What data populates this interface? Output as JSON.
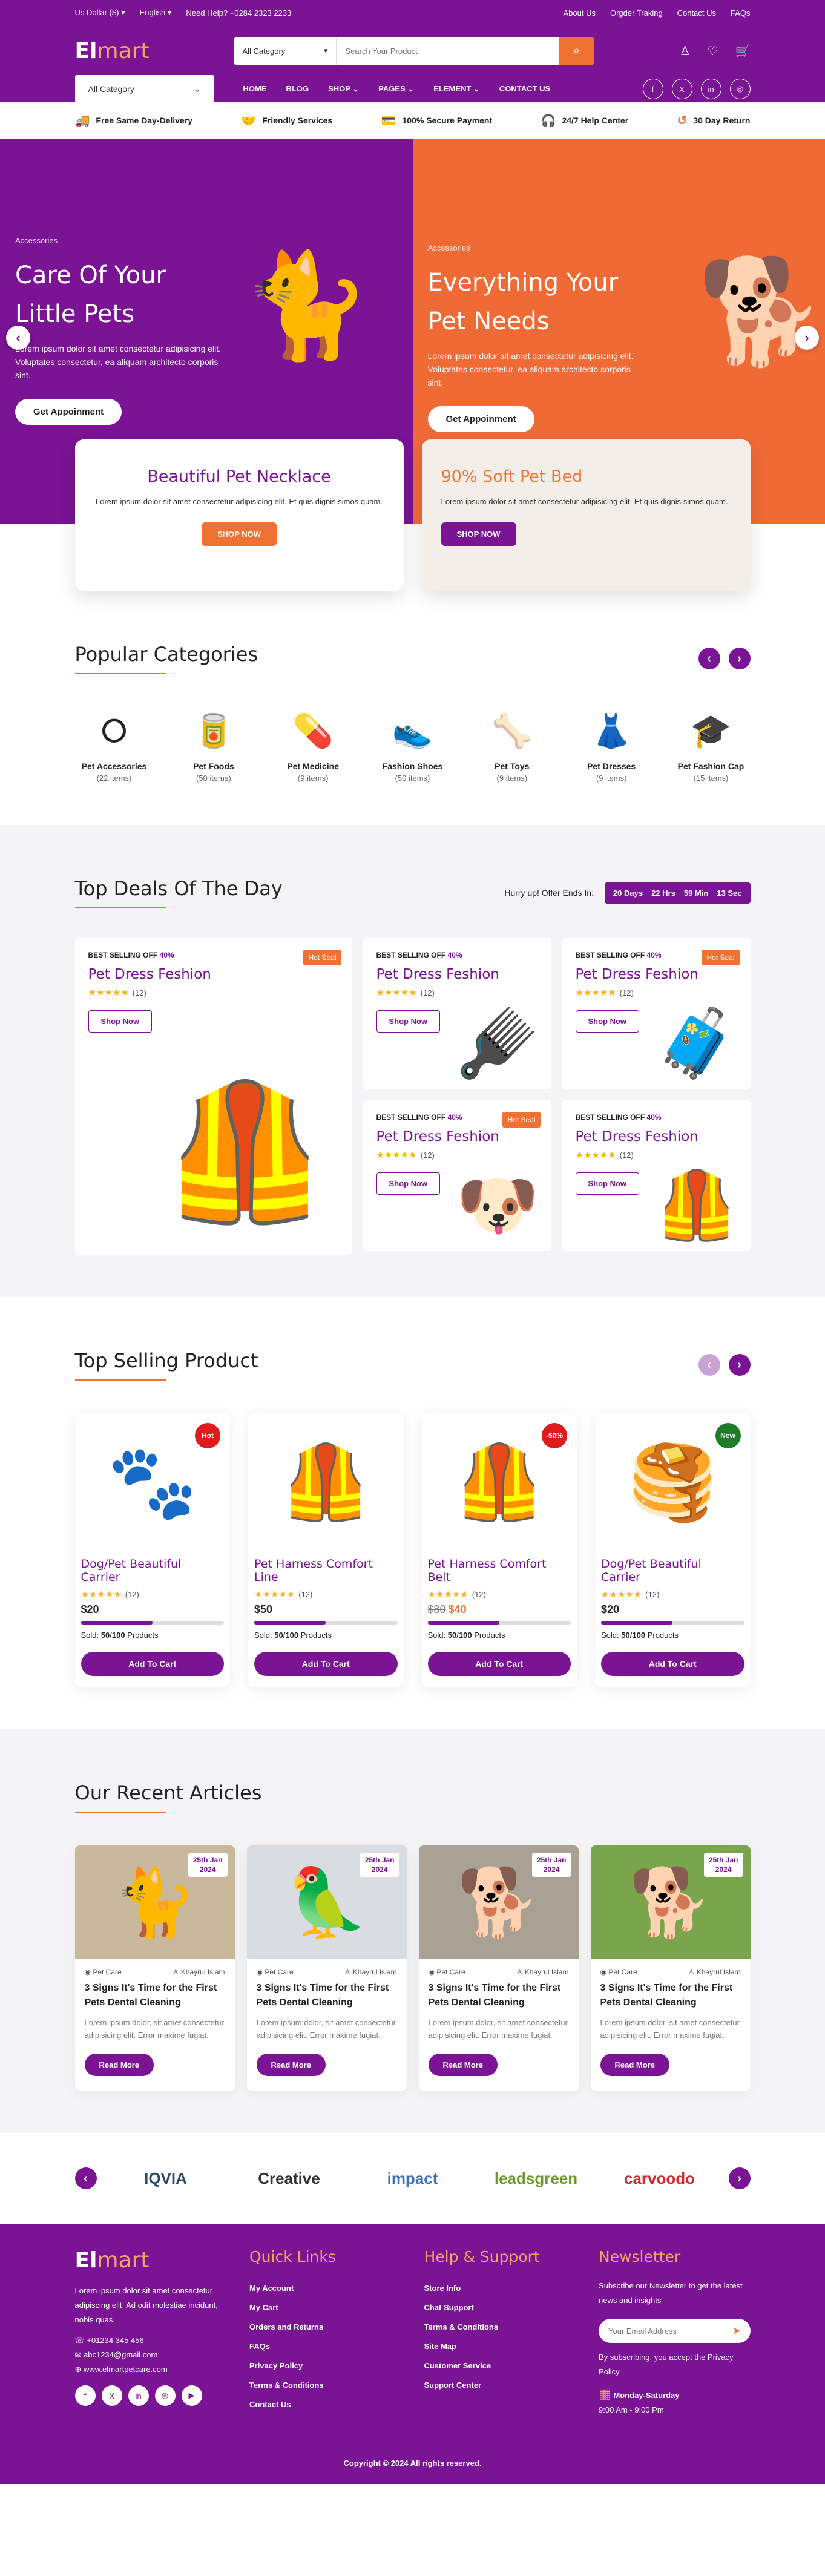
{
  "topbar": {
    "currency": "Us Dollar ($)",
    "language": "English",
    "help": "Need Help? +0284 2323 2233",
    "links": [
      "About Us",
      "Orgder Traking",
      "Contact Us",
      "FAQs"
    ]
  },
  "header": {
    "logo_a": "El",
    "logo_b": "mart",
    "search_cat": "All Category",
    "search_placeholder": "Search Your Product",
    "all_category": "All Category",
    "nav": [
      "HOME",
      "BLOG",
      "SHOP",
      "PAGES",
      "ELEMENT",
      "CONTACT US"
    ]
  },
  "features": [
    "Free Same Day-Delivery",
    "Friendly Services",
    "100% Secure Payment",
    "24/7 Help Center",
    "30 Day Return"
  ],
  "hero": {
    "left": {
      "tag": "Accessories",
      "title": "Care Of Your Little Pets",
      "desc": "Lorem ipsum dolor sit amet consectetur adipisicing elit. Voluptates consectetur, ea aliquam architecto corporis sint.",
      "btn": "Get Appoinment"
    },
    "right": {
      "tag": "Accessories",
      "title": "Everything Your Pet Needs",
      "desc": "Lorem ipsum dolor sit amet consectetur adipisicing elit. Voluptates consectetur, ea aliquam architecto corporis sint.",
      "btn": "Get Appoinment"
    }
  },
  "promo": [
    {
      "title": "Beautiful Pet Necklace",
      "desc": "Lorem ipsum dolor sit amet consectetur adipisicing elit. Et quis dignis simos quam.",
      "btn": "SHOP NOW"
    },
    {
      "title": "90% Soft Pet Bed",
      "desc": "Lorem ipsum dolor sit amet consectetur adipisicing elit. Et quis dignis simos quam.",
      "btn": "SHOP NOW"
    }
  ],
  "categories": {
    "title": "Popular Categories",
    "items": [
      {
        "name": "Pet Accessories",
        "count": "(22 items)",
        "icon": "collar-icon"
      },
      {
        "name": "Pet Foods",
        "count": "(50 items)",
        "icon": "food-icon"
      },
      {
        "name": "Pet Medicine",
        "count": "(9 items)",
        "icon": "medicine-icon"
      },
      {
        "name": "Fashion Shoes",
        "count": "(50 items)",
        "icon": "shoes-icon"
      },
      {
        "name": "Pet Toys",
        "count": "(9 items)",
        "icon": "bone-icon"
      },
      {
        "name": "Pet Dresses",
        "count": "(9 items)",
        "icon": "dress-icon"
      },
      {
        "name": "Pet Fashion Cap",
        "count": "(15 items)",
        "icon": "cap-icon"
      }
    ]
  },
  "deals": {
    "title": "Top Deals Of The Day",
    "hurry": "Hurry up! Offer Ends In:",
    "timer": [
      "20 Days",
      "22 Hrs",
      "59 Min",
      "13 Sec"
    ],
    "label": "BEST SELLING OFF",
    "off": "40%",
    "name": "Pet Dress Feshion",
    "reviews": "(12)",
    "btn": "Shop Now",
    "hot": "Hot Seal"
  },
  "selling": {
    "title": "Top Selling Product",
    "items": [
      {
        "name": "Dog/Pet Beautiful Carrier",
        "price": "$20",
        "old": "",
        "badge": "Hot",
        "bc": "#e01b1b",
        "sold": "50",
        "total": "100"
      },
      {
        "name": "Pet Harness Comfort Line",
        "price": "$50",
        "old": "",
        "badge": "",
        "bc": "",
        "sold": "50",
        "total": "100"
      },
      {
        "name": "Pet Harness Comfort Belt",
        "price": "$40",
        "old": "$80",
        "badge": "-50%",
        "bc": "#e01b1b",
        "sold": "50",
        "total": "100"
      },
      {
        "name": "Dog/Pet Beautiful Carrier",
        "price": "$20",
        "old": "",
        "badge": "New",
        "bc": "#1f7d2a",
        "sold": "50",
        "total": "100"
      }
    ],
    "reviews": "(12)",
    "sold_label": "Sold:",
    "products": "Products",
    "btn": "Add To Cart"
  },
  "articles": {
    "title": "Our Recent Articles",
    "items": [
      {
        "day": "25th Jan",
        "year": "2024",
        "cat": "Pet Care",
        "author": "Khayrul Islam",
        "title": "3 Signs It's Time for the First Pets Dental Cleaning",
        "desc": "Lorem ipsum dolor, sit amet consectetur adipisicing elit. Error maxime fugiat."
      },
      {
        "day": "25th Jan",
        "year": "2024",
        "cat": "Pet Care",
        "author": "Khayrul Islam",
        "title": "3 Signs It's Time for the First Pets Dental Cleaning",
        "desc": "Lorem ipsum dolor, sit amet consectetur adipisicing elit. Error maxime fugiat."
      },
      {
        "day": "25th Jan",
        "year": "2024",
        "cat": "Pet Care",
        "author": "Khayrul Islam",
        "title": "3 Signs It's Time for the First Pets Dental Cleaning",
        "desc": "Lorem ipsum dolor, sit amet consectetur adipisicing elit. Error maxime fugiat."
      },
      {
        "day": "25th Jan",
        "year": "2024",
        "cat": "Pet Care",
        "author": "Khayrul Islam",
        "title": "3 Signs It's Time for the First Pets Dental Cleaning",
        "desc": "Lorem ipsum dolor, sit amet consectetur adipisicing elit. Error maxime fugiat."
      }
    ],
    "btn": "Read More"
  },
  "brands": [
    "IQVIA",
    "Creative",
    "impact",
    "leadsgreen",
    "carvoodo"
  ],
  "footer": {
    "about": "Lorem ipsum dolor sit amet consectetur adipiscing elit. Ad odit molestiae incidunt, nobis quas.",
    "phone": "+01234 345 456",
    "email": "abc1234@gmail.com",
    "web": "www.elmartpetcare.com",
    "quick_title": "Quick Links",
    "quick": [
      "My Account",
      "My Cart",
      "Orders and Returns",
      "FAQs",
      "Privacy Policy",
      "Terms & Conditions",
      "Contact Us"
    ],
    "help_title": "Help & Support",
    "help": [
      "Store Info",
      "Chat Support",
      "Terms & Conditions",
      "Site Map",
      "Customer Service",
      "Support Center"
    ],
    "news_title": "Newsletter",
    "news_desc": "Subscribe our Newsletter to get the latest news and insights",
    "news_ph": "Your Email Address",
    "news_note": "By subscribing, you accept the Privacy Policy",
    "days": "Monday-Saturday",
    "hours": "9:00 Am - 9:00 Pm",
    "copy": "Copyright © 2024 All rights reserved."
  }
}
